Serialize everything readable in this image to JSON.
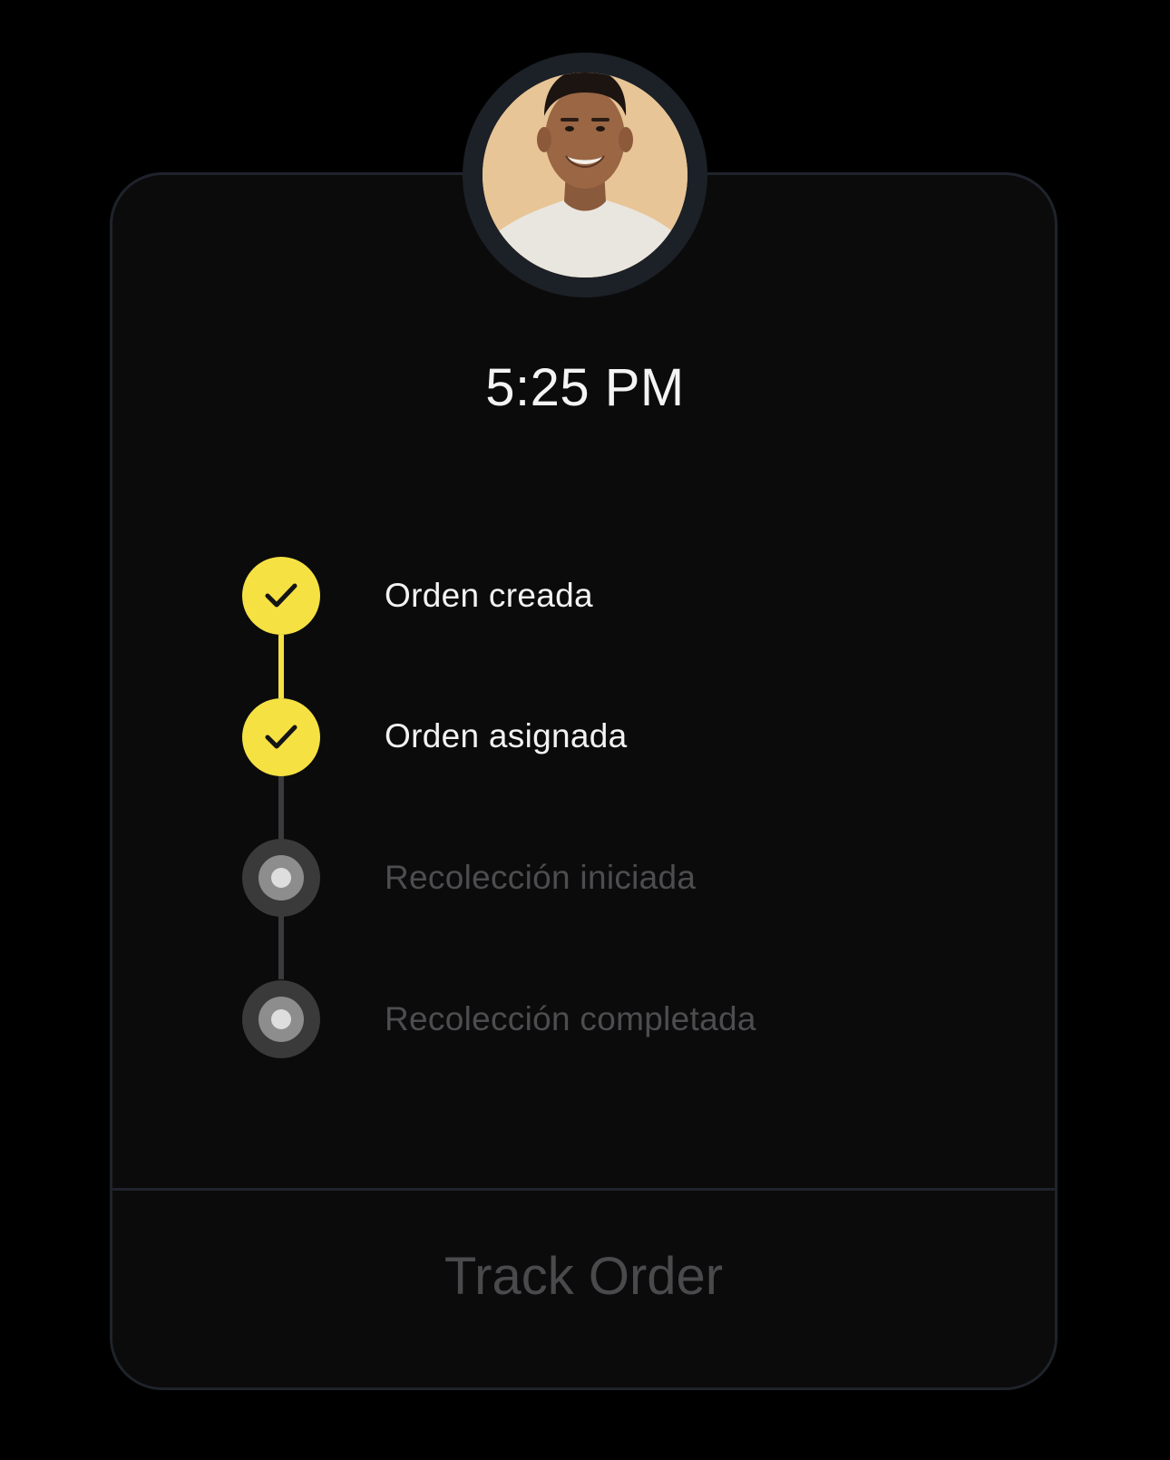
{
  "header": {
    "avatar_icon": "person-photo",
    "time": "5:25 PM"
  },
  "steps": [
    {
      "label": "Orden creada",
      "status": "done",
      "icon": "check-icon"
    },
    {
      "label": "Orden asignada",
      "status": "done",
      "icon": "check-icon"
    },
    {
      "label": "Recolección iniciada",
      "status": "pending",
      "icon": "radio-dot-icon"
    },
    {
      "label": "Recolección completada",
      "status": "pending",
      "icon": "radio-dot-icon"
    }
  ],
  "footer": {
    "track_label": "Track Order"
  },
  "colors": {
    "accent": "#f5e142",
    "card_background": "#0b0b0c",
    "card_border": "#1f232b",
    "pending_text": "#4d4d50",
    "done_text": "#f2f2f2"
  }
}
